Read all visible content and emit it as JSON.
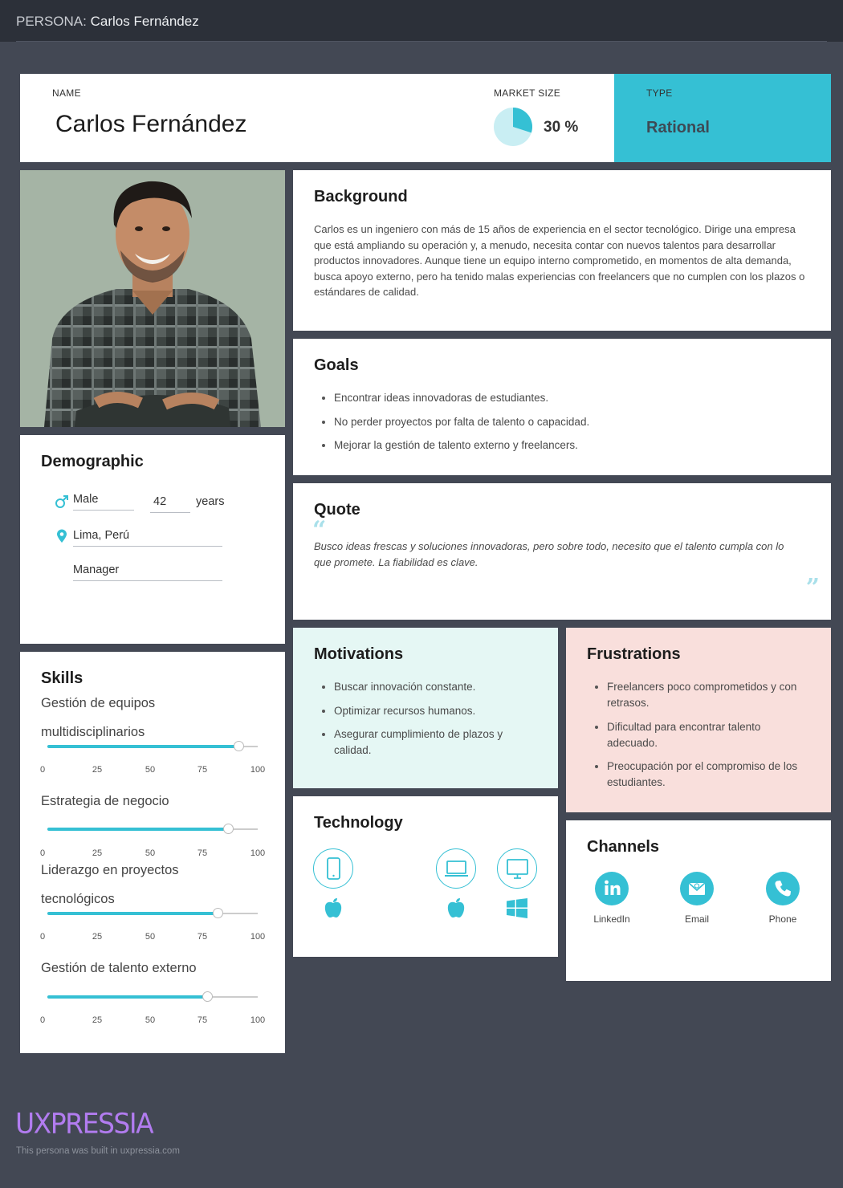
{
  "header": {
    "prefix": "PERSONA:",
    "name": "Carlos Fernández"
  },
  "summary": {
    "name_label": "NAME",
    "name": "Carlos Fernández",
    "market_label": "MARKET SIZE",
    "market_value": "30 %",
    "market_fraction": 0.3,
    "type_label": "TYPE",
    "type_value": "Rational"
  },
  "colors": {
    "accent": "#35c0d4",
    "dark_bg": "#434854",
    "topbar": "#2c3039",
    "motivations_bg": "#e5f7f4",
    "frustrations_bg": "#f9dfdc",
    "brand": "#b27cf0"
  },
  "photo": {
    "icon": "portrait-photo"
  },
  "demographic": {
    "title": "Demographic",
    "gender": "Male",
    "gender_icon": "male-icon",
    "age": "42",
    "age_unit": "years",
    "location": "Lima, Perú",
    "location_icon": "location-pin-icon",
    "occupation": "Manager"
  },
  "skills": {
    "title": "Skills",
    "scale": [
      "0",
      "25",
      "50",
      "75",
      "100"
    ],
    "items": [
      {
        "name_lines": [
          "Gestión de equipos",
          "multidisciplinarios"
        ],
        "value": 91
      },
      {
        "name_lines": [
          "Estrategia de negocio"
        ],
        "value": 86
      },
      {
        "name_lines": [
          "Liderazgo en proyectos",
          "tecnológicos"
        ],
        "value": 81
      },
      {
        "name_lines": [
          "Gestión de talento externo"
        ],
        "value": 76
      }
    ]
  },
  "background": {
    "title": "Background",
    "text": "Carlos es un ingeniero con más de 15 años de experiencia en el sector tecnológico. Dirige una empresa que está ampliando su operación y, a menudo, necesita contar con nuevos talentos para desarrollar productos innovadores. Aunque tiene un equipo interno comprometido, en momentos de alta demanda, busca apoyo externo, pero ha tenido malas experiencias con freelancers que no cumplen con los plazos o estándares de calidad."
  },
  "goals": {
    "title": "Goals",
    "items": [
      "Encontrar ideas innovadoras de estudiantes.",
      "No perder proyectos por falta de talento o capacidad.",
      "Mejorar la gestión de talento externo y freelancers."
    ]
  },
  "quote": {
    "title": "Quote",
    "text": "Busco ideas frescas y soluciones innovadoras, pero sobre todo, necesito que el talento cumpla con lo que promete. La fiabilidad es clave."
  },
  "motivations": {
    "title": "Motivations",
    "items": [
      "Buscar innovación constante.",
      "Optimizar recursos humanos.",
      "Asegurar cumplimiento de plazos y calidad."
    ]
  },
  "frustrations": {
    "title": "Frustrations",
    "items": [
      "Freelancers poco comprometidos y con retrasos.",
      "Dificultad para encontrar talento adecuado.",
      "Preocupación por el compromiso de los estudiantes."
    ]
  },
  "technology": {
    "title": "Technology",
    "devices": [
      {
        "icon": "smartphone-icon",
        "os_icon": "apple-icon"
      },
      {
        "icon": "laptop-icon",
        "os_icon": "apple-icon"
      },
      {
        "icon": "desktop-icon",
        "os_icon": "windows-icon"
      }
    ]
  },
  "channels": {
    "title": "Channels",
    "items": [
      {
        "label": "LinkedIn",
        "icon": "linkedin-icon"
      },
      {
        "label": "Email",
        "icon": "email-icon"
      },
      {
        "label": "Phone",
        "icon": "phone-icon"
      }
    ]
  },
  "footer": {
    "brand": "UXPRESSIA",
    "note": "This persona was built in uxpressia.com"
  }
}
